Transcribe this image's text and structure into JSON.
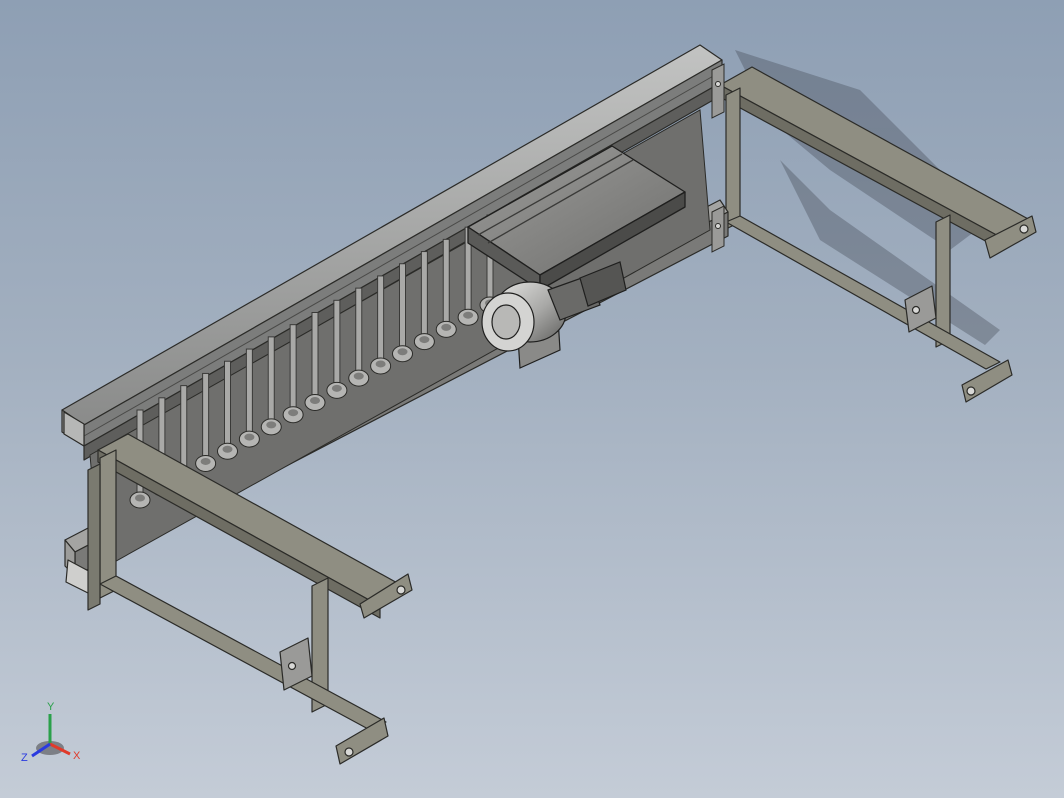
{
  "viewport": {
    "background_top": "#8e9fb4",
    "background_bottom": "#c4ccd7"
  },
  "model": {
    "frame_color": "#8f8e82",
    "frame_dark": "#4a4a44",
    "rail_color": "#9a9a98",
    "roller_count": 17,
    "components": [
      "aluminum-rail-beam",
      "roller-conveyor",
      "drive-motor",
      "motor-gearbox",
      "carriage-plate",
      "front-support-frame",
      "rear-support-frame",
      "foot-pads",
      "mounting-brackets"
    ]
  },
  "triad": {
    "x_label": "X",
    "y_label": "Y",
    "z_label": "Z",
    "x_color": "#e03a2a",
    "y_color": "#2aa04a",
    "z_color": "#2a3ae0"
  }
}
